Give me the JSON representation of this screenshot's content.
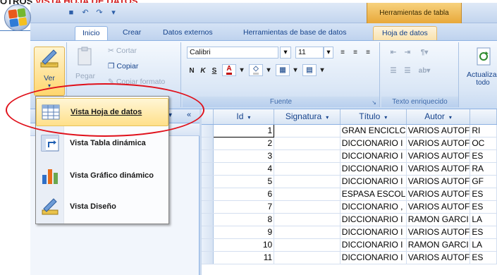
{
  "caption": {
    "part1": "OTROS",
    "part2": "VISTA HOJA DE DATOS"
  },
  "titlebar": {
    "context_title": "Herramientas de tabla"
  },
  "tabs": [
    "Inicio",
    "Crear",
    "Datos externos",
    "Herramientas de base de datos",
    "Hoja de datos"
  ],
  "ribbon": {
    "views": {
      "ver_label": "Ver"
    },
    "clipboard": {
      "paste_label": "Pegar",
      "cut_label": "Cortar",
      "copy_label": "Copiar",
      "format_painter_label": "Copiar formato"
    },
    "font": {
      "font_name": "Calibri",
      "font_size": "11",
      "group_label": "Fuente",
      "bold": "N",
      "italic": "K",
      "underline": "S"
    },
    "rich_text": {
      "group_label": "Texto enriquecido"
    },
    "records": {
      "refresh_label": "Actualizar",
      "refresh_sub": "todo"
    }
  },
  "menu": {
    "items": [
      {
        "label": "Vista Hoja de datos",
        "icon": "datasheet-view-icon"
      },
      {
        "label": "Vista Tabla dinámica",
        "icon": "pivot-table-icon"
      },
      {
        "label": "Vista Gráfico dinámico",
        "icon": "pivot-chart-icon"
      },
      {
        "label": "Vista Diseño",
        "icon": "design-view-icon"
      }
    ]
  },
  "datasheet": {
    "columns": [
      "Id",
      "Signatura",
      "Título",
      "Autor",
      ""
    ],
    "rows": [
      {
        "id": "1",
        "signatura": "",
        "titulo": "GRAN ENCICLC",
        "autor": "VARIOS AUTOF",
        "extra": "RI"
      },
      {
        "id": "2",
        "signatura": "",
        "titulo": "DICCIONARIO I",
        "autor": "VARIOS AUTOF",
        "extra": "OC"
      },
      {
        "id": "3",
        "signatura": "",
        "titulo": "DICCIONARIO I",
        "autor": "VARIOS AUTOF",
        "extra": "ES"
      },
      {
        "id": "4",
        "signatura": "",
        "titulo": "DICCIONARIO I",
        "autor": "VARIOS AUTOF",
        "extra": "RA"
      },
      {
        "id": "5",
        "signatura": "",
        "titulo": "DICCIONARIO I",
        "autor": "VARIOS AUTOF",
        "extra": "GF"
      },
      {
        "id": "6",
        "signatura": "",
        "titulo": "ESPASA ESCOL",
        "autor": "VARIOS AUTOF",
        "extra": "ES"
      },
      {
        "id": "7",
        "signatura": "",
        "titulo": "DICCIONARIO ,",
        "autor": "VARIOS AUTOF",
        "extra": "ES"
      },
      {
        "id": "8",
        "signatura": "",
        "titulo": "DICCIONARIO I",
        "autor": "RAMON GARCI",
        "extra": "LA"
      },
      {
        "id": "9",
        "signatura": "",
        "titulo": "DICCIONARIO I",
        "autor": "VARIOS AUTOF",
        "extra": "ES"
      },
      {
        "id": "10",
        "signatura": "",
        "titulo": "DICCIONARIO I",
        "autor": "RAMON GARCI",
        "extra": "LA"
      },
      {
        "id": "11",
        "signatura": "",
        "titulo": "DICCIONARIO I",
        "autor": "VARIOS AUTOF",
        "extra": "ES"
      }
    ]
  },
  "colors": {
    "highlight": "#e0101a",
    "caption_red": "#d42020",
    "ribbon_blue": "#15428b"
  }
}
